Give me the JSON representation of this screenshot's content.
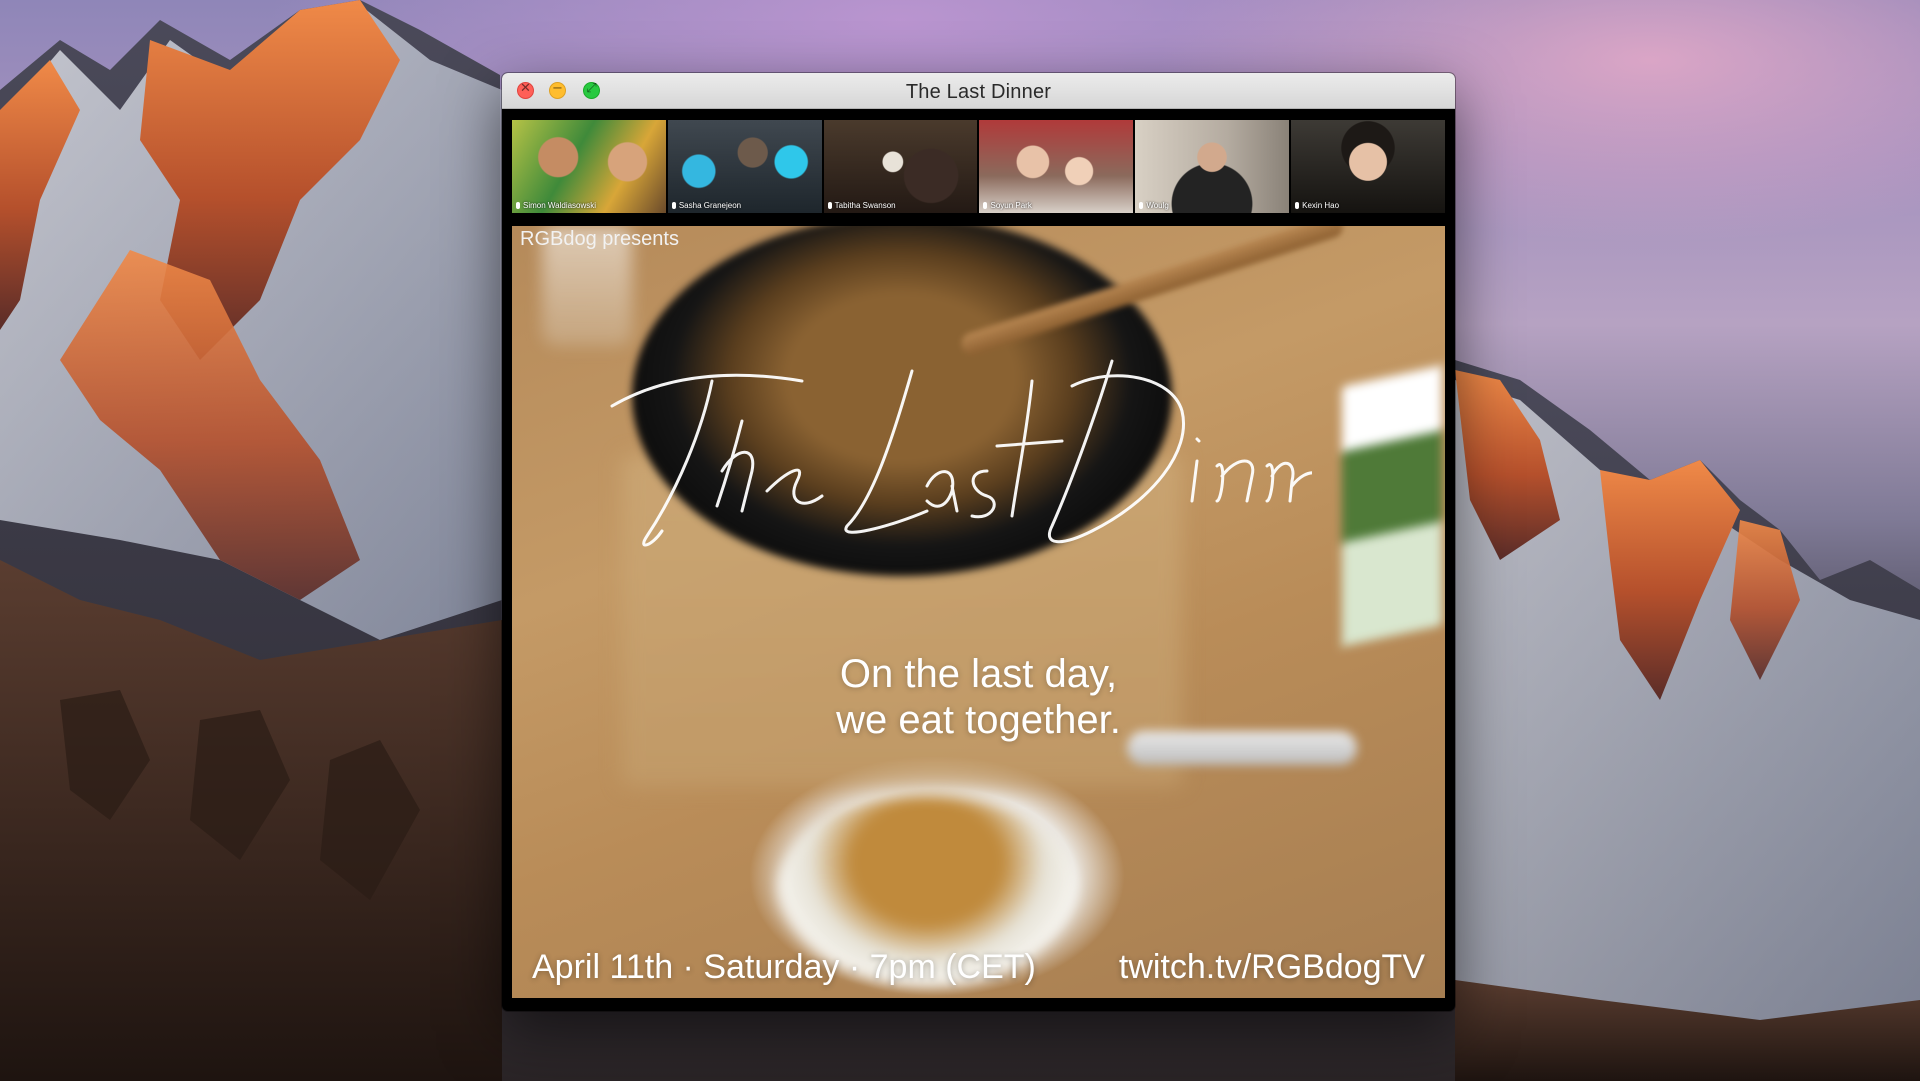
{
  "window": {
    "title": "The Last Dinner",
    "controls": {
      "close_icon": "✕",
      "minimize_icon": "−",
      "maximize_icon": "⤢"
    }
  },
  "participants": [
    {
      "name": "Simon Waldiasowski"
    },
    {
      "name": "Sasha Granejeon"
    },
    {
      "name": "Tabitha Swanson"
    },
    {
      "name": "Soyun Park"
    },
    {
      "name": "Woulg"
    },
    {
      "name": "Kexin Hao"
    }
  ],
  "stage": {
    "presents": "RGBdog presents",
    "title_script": "The Last Dinner",
    "tagline": [
      "On the last day,",
      "we eat together."
    ],
    "date_time": "April 11th · Saturday · 7pm (CET)",
    "link": "twitch.tv/RGBdogTV"
  },
  "colors": {
    "close": "#ff5f57",
    "minimize": "#ffbd2e",
    "maximize": "#28c940"
  }
}
